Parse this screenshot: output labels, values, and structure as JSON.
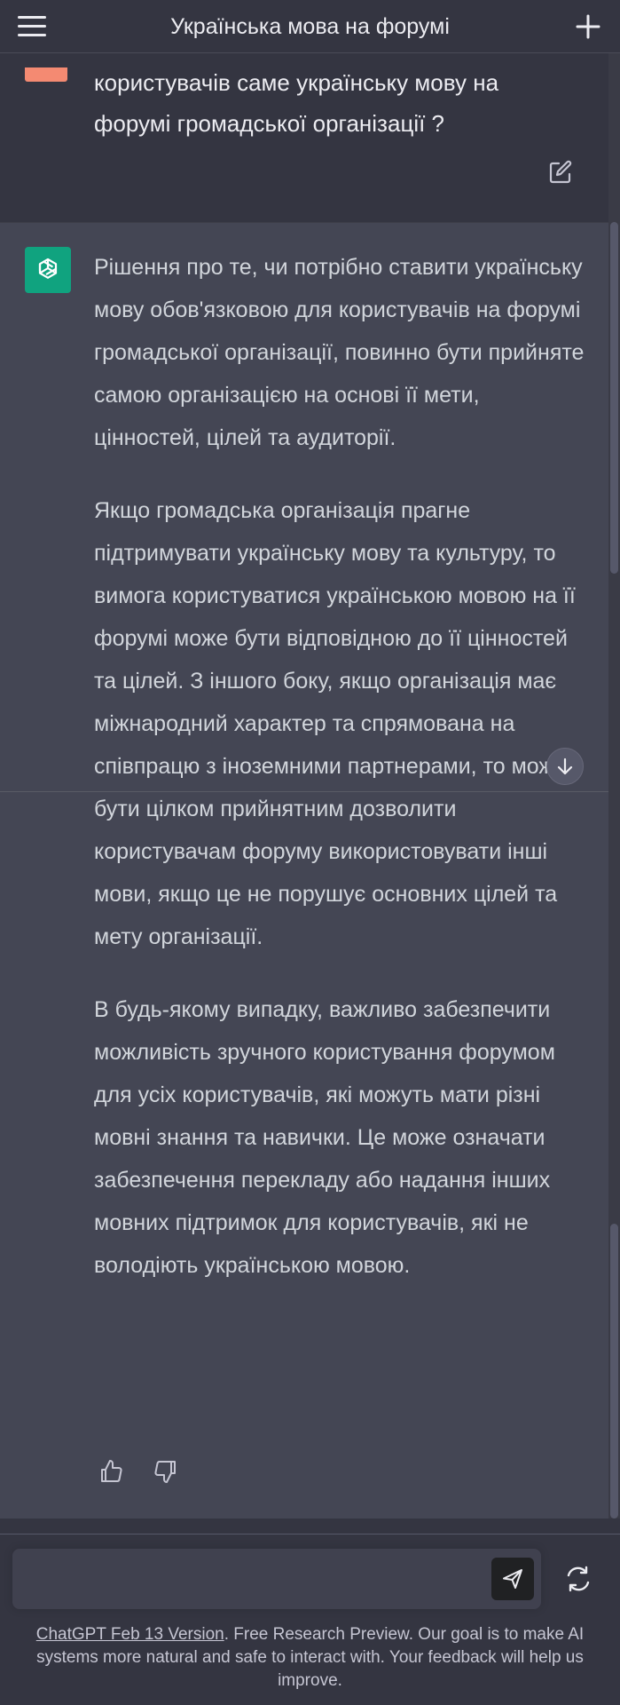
{
  "header": {
    "title": "Українська мова на форумі"
  },
  "user_message": {
    "lines": [
      "користувачів саме українську мову на",
      "форумі громадської організації ?"
    ]
  },
  "assistant_message": {
    "paragraphs": [
      "Рішення про те, чи потрібно ставити українську мову обов'язковою для користувачів на форумі громадської організації, повинно бути прийняте самою організацією на основі її мети, цінностей, цілей та аудиторії.",
      "Якщо громадська організація прагне підтримувати українську мову та культуру, то вимога користуватися українською мовою на її форумі може бути відповідною до її цінностей та цілей. З іншого боку, якщо організація має міжнародний характер та спрямована на співпрацю з іноземними партнерами, то може бути цілком прийнятним дозволити користувачам форуму використовувати інші мови, якщо це не порушує основних цілей та мету організації.",
      "В будь-якому випадку, важливо забезпечити можливість зручного користування форумом для усіх користувачів, які можуть мати різні мовні знання та навички. Це може означати забезпечення перекладу або надання інших мовних підтримок для користувачів, які не володіють українською мовою."
    ]
  },
  "composer": {
    "input_value": ""
  },
  "footer": {
    "version_link": "ChatGPT Feb 13 Version",
    "text": ". Free Research Preview. Our goal is to make AI systems more natural and safe to interact with. Your feedback will help us improve."
  },
  "icons": {
    "menu": "hamburger-menu-icon",
    "new_chat": "plus-icon",
    "edit": "edit-icon",
    "assistant_avatar": "openai-logo-icon",
    "thumbs_up": "thumbs-up-icon",
    "thumbs_down": "thumbs-down-icon",
    "scroll_down": "arrow-down-icon",
    "send": "paper-plane-icon",
    "regenerate": "refresh-icon"
  },
  "colors": {
    "background": "#343541",
    "assistant_background": "#444654",
    "user_avatar": "#f48a72",
    "assistant_avatar": "#10a37f"
  }
}
